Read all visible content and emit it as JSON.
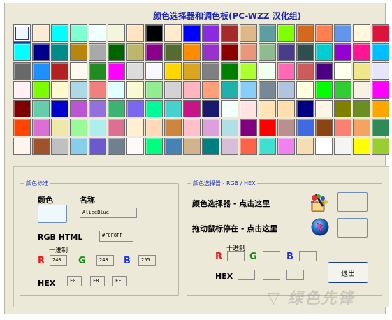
{
  "app": {
    "title": "颜色选择器和调色板(PC-WZZ 汉化组)"
  },
  "palette": {
    "selected_index": 0,
    "colors": [
      [
        "#F0F8FF",
        "#FAEBD7",
        "#00FFFF",
        "#7FFFD4",
        "#F0FFFF",
        "#F5F5DC",
        "#FFE4C4",
        "#000000",
        "#FFEBCD",
        "#0000FF",
        "#8A2BE2",
        "#A52A2A",
        "#DEB887",
        "#5F9EA0",
        "#7FFF00",
        "#D2691E",
        "#FF7F50",
        "#6495ED",
        "#FFF8DC",
        "#DC143C"
      ],
      [
        "#00FFFF",
        "#00008B",
        "#008B8B",
        "#B8860B",
        "#A9A9A9",
        "#006400",
        "#BDB76B",
        "#8B008B",
        "#556B2F",
        "#FF8C00",
        "#9932CC",
        "#8B0000",
        "#E9967A",
        "#8FBC8F",
        "#483D8B",
        "#2F4F4F",
        "#00CED1",
        "#9400D3",
        "#FF1493",
        "#00BFFF"
      ],
      [
        "#696969",
        "#1E90FF",
        "#B22222",
        "#FFFAF0",
        "#228B22",
        "#FF00FF",
        "#DCDCDC",
        "#F8F8FF",
        "#FFD700",
        "#DAA520",
        "#808080",
        "#008000",
        "#ADFF2F",
        "#F0FFF0",
        "#FF69B4",
        "#CD5C5C",
        "#4B0082",
        "#FFFFF0",
        "#F0E68C",
        "#E6E6FA"
      ],
      [
        "#FFF0F5",
        "#7CFC00",
        "#FFFACD",
        "#ADD8E6",
        "#F08080",
        "#E0FFFF",
        "#FAFAD2",
        "#90EE90",
        "#D3D3D3",
        "#FFB6C1",
        "#FFA07A",
        "#20B2AA",
        "#87CEFA",
        "#778899",
        "#B0C4DE",
        "#FFFFE0",
        "#00FF00",
        "#32CD32",
        "#FAF0E6",
        "#FF00FF"
      ],
      [
        "#800000",
        "#66CDAA",
        "#0000CD",
        "#BA55D3",
        "#9370DB",
        "#3CB371",
        "#7B68EE",
        "#00FA9A",
        "#48D1CC",
        "#C71585",
        "#191970",
        "#F5FFFA",
        "#FFE4E1",
        "#FFE4B5",
        "#FFDEAD",
        "#000080",
        "#FDF5E6",
        "#808000",
        "#6B8E23",
        "#FFA500"
      ],
      [
        "#FF4500",
        "#DA70D6",
        "#EEE8AA",
        "#98FB98",
        "#AFEEEE",
        "#DB7093",
        "#FFEFD5",
        "#FFDAB9",
        "#CD853F",
        "#FFC0CB",
        "#DDA0DD",
        "#B0E0E6",
        "#800080",
        "#FF0000",
        "#BC8F8F",
        "#4169E1",
        "#8B4513",
        "#FA8072",
        "#F4A460",
        "#2E8B57"
      ],
      [
        "#FFF5EE",
        "#A0522D",
        "#C0C0C0",
        "#87CEEB",
        "#6A5ACD",
        "#708090",
        "#FFFAFA",
        "#00FF7F",
        "#4682B4",
        "#D2B48C",
        "#008080",
        "#D8BFD8",
        "#FF6347",
        "#40E0D0",
        "#EE82EE",
        "#F5DEB3",
        "#FFFFFF",
        "#F5F5F5",
        "#FFFF00",
        "#9ACD32"
      ]
    ]
  },
  "color_standard": {
    "legend": "颜色标准",
    "color_label": "颜色",
    "name_label": "名称",
    "name_value": "AliceBlue",
    "preview_color": "#F0F8FF",
    "rgb_html_label": "RGB HTML",
    "rgb_html_value": "#F0F8FF",
    "decimal_label": "十进制",
    "r_label": "R",
    "g_label": "G",
    "b_label": "B",
    "r_value": "240",
    "g_value": "248",
    "b_value": "255",
    "hex_label": "HEX",
    "hex_r": "F0",
    "hex_g": "F8",
    "hex_b": "FF"
  },
  "color_picker": {
    "legend": "颜色选择器 - RGB / HEX",
    "picker_label": "颜色选择器 - 点击这里",
    "hover_label": "拖动鼠标停在 - 点击这里",
    "decimal_label": "十进制",
    "r_label": "R",
    "g_label": "G",
    "b_label": "B",
    "r_value": "",
    "g_value": "",
    "b_value": "",
    "hex_label": "HEX",
    "hex_r": "",
    "hex_g": "",
    "hex_b": "",
    "exit_label": "退出"
  },
  "colors": {
    "title": "#1E28B4",
    "legend": "#1E32B4",
    "r": "#E11E1E",
    "g": "#148C14",
    "b": "#1E32DC"
  }
}
